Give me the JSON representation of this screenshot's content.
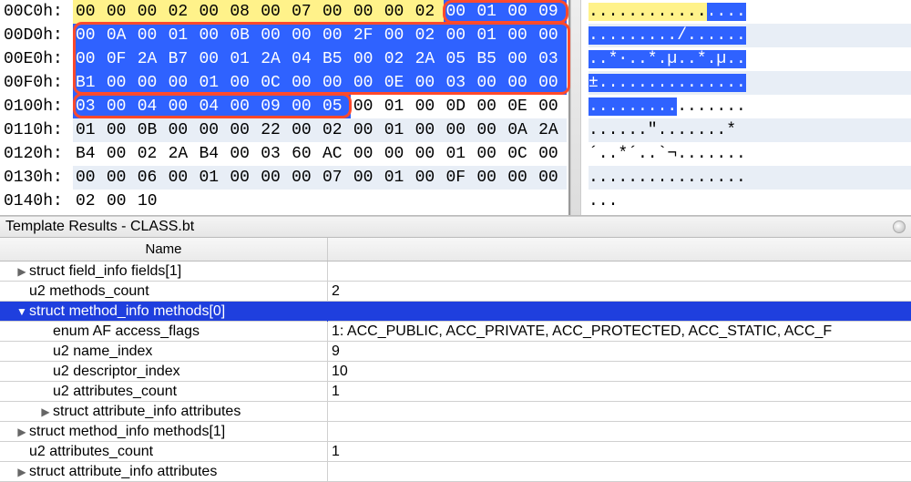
{
  "hex": {
    "addresses": [
      "00C0h:",
      "00D0h:",
      "00E0h:",
      "00F0h:",
      "0100h:",
      "0110h:",
      "0120h:",
      "0130h:",
      "0140h:"
    ],
    "rows": [
      [
        "00",
        "00",
        "00",
        "02",
        "00",
        "08",
        "00",
        "07",
        "00",
        "00",
        "00",
        "02",
        "00",
        "01",
        "00",
        "09"
      ],
      [
        "00",
        "0A",
        "00",
        "01",
        "00",
        "0B",
        "00",
        "00",
        "00",
        "2F",
        "00",
        "02",
        "00",
        "01",
        "00",
        "00"
      ],
      [
        "00",
        "0F",
        "2A",
        "B7",
        "00",
        "01",
        "2A",
        "04",
        "B5",
        "00",
        "02",
        "2A",
        "05",
        "B5",
        "00",
        "03"
      ],
      [
        "B1",
        "00",
        "00",
        "00",
        "01",
        "00",
        "0C",
        "00",
        "00",
        "00",
        "0E",
        "00",
        "03",
        "00",
        "00",
        "00"
      ],
      [
        "03",
        "00",
        "04",
        "00",
        "04",
        "00",
        "09",
        "00",
        "05",
        "00",
        "01",
        "00",
        "0D",
        "00",
        "0E",
        "00"
      ],
      [
        "01",
        "00",
        "0B",
        "00",
        "00",
        "00",
        "22",
        "00",
        "02",
        "00",
        "01",
        "00",
        "00",
        "00",
        "0A",
        "2A"
      ],
      [
        "B4",
        "00",
        "02",
        "2A",
        "B4",
        "00",
        "03",
        "60",
        "AC",
        "00",
        "00",
        "00",
        "01",
        "00",
        "0C",
        "00"
      ],
      [
        "00",
        "00",
        "06",
        "00",
        "01",
        "00",
        "00",
        "00",
        "07",
        "00",
        "01",
        "00",
        "0F",
        "00",
        "00",
        "00"
      ],
      [
        "02",
        "00",
        "10"
      ]
    ],
    "ascii": [
      "................",
      "........./......",
      "..*·..*.µ..*.µ..",
      "±...............",
      "................",
      "......\".......*",
      "´..*´..`¬.......",
      "................",
      "..."
    ]
  },
  "results": {
    "title": "Template Results - CLASS.bt",
    "name_header": "Name",
    "rows": [
      {
        "indent": 1,
        "disc": "▶",
        "name": "struct field_info fields[1]",
        "val": ""
      },
      {
        "indent": 1,
        "disc": "",
        "name": "u2 methods_count",
        "val": "2"
      },
      {
        "indent": 1,
        "disc": "▼",
        "name": "struct method_info methods[0]",
        "val": "",
        "selected": true
      },
      {
        "indent": 2,
        "disc": "",
        "name": "enum AF access_flags",
        "val": "1: ACC_PUBLIC, ACC_PRIVATE, ACC_PROTECTED, ACC_STATIC, ACC_F"
      },
      {
        "indent": 2,
        "disc": "",
        "name": "u2 name_index",
        "val": "9"
      },
      {
        "indent": 2,
        "disc": "",
        "name": "u2 descriptor_index",
        "val": "10"
      },
      {
        "indent": 2,
        "disc": "",
        "name": "u2 attributes_count",
        "val": "1"
      },
      {
        "indent": 2,
        "disc": "▶",
        "name": "struct attribute_info attributes",
        "val": ""
      },
      {
        "indent": 1,
        "disc": "▶",
        "name": "struct method_info methods[1]",
        "val": ""
      },
      {
        "indent": 1,
        "disc": "",
        "name": "u2 attributes_count",
        "val": "1"
      },
      {
        "indent": 1,
        "disc": "▶",
        "name": "struct attribute_info attributes",
        "val": ""
      }
    ]
  }
}
